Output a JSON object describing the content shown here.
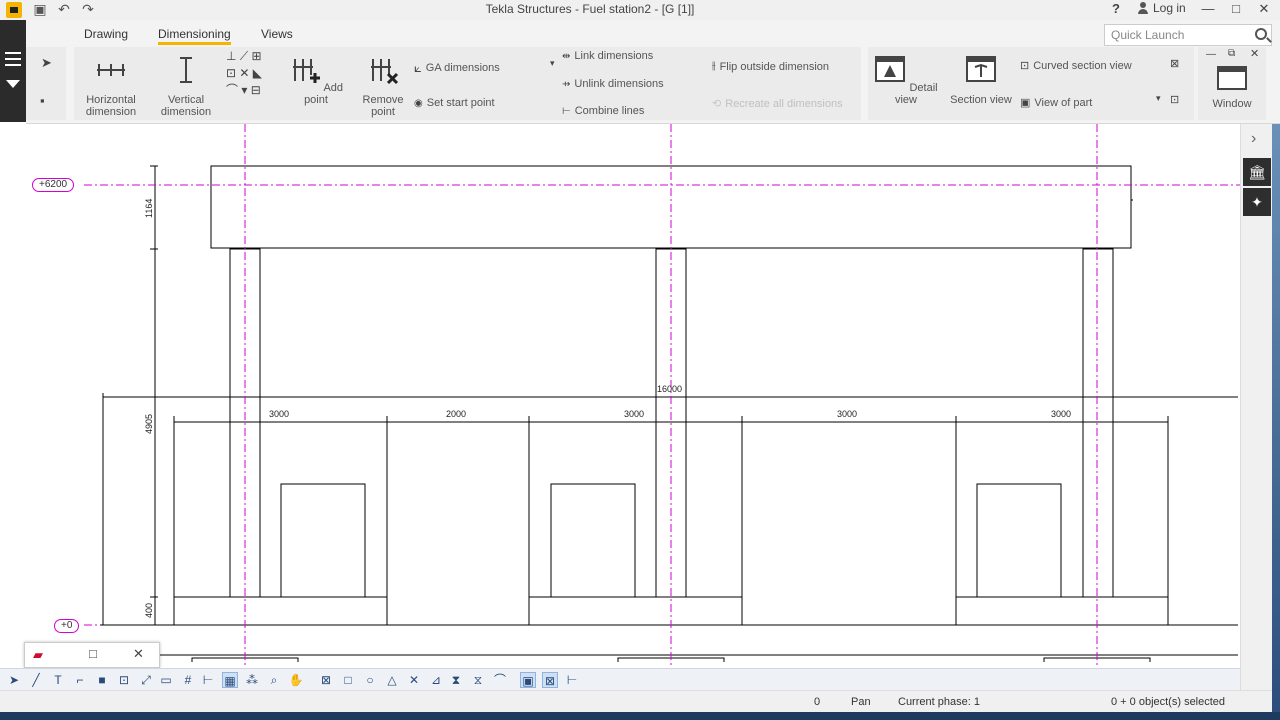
{
  "titlebar": {
    "title": "Tekla Structures - Fuel station2 - [G  [1]]",
    "help": "?",
    "login": "Log in",
    "minimize": "—",
    "restore": "□",
    "close": "✕"
  },
  "tabs": [
    {
      "label": "Drawing"
    },
    {
      "label": "Dimensioning"
    },
    {
      "label": "Views"
    }
  ],
  "quick_launch": {
    "placeholder": "Quick Launch"
  },
  "ribbon": {
    "horizontal_dimension": "Horizontal dimension",
    "vertical_dimension": "Vertical dimension",
    "add_point": "Add point",
    "remove_point": "Remove point",
    "ga_dimensions": "GA dimensions",
    "set_start_point": "Set start point",
    "link_dimensions": "Link dimensions",
    "unlink_dimensions": "Unlink dimensions",
    "combine_lines": "Combine lines",
    "flip_outside_dimension": "Flip outside dimension",
    "recreate_all_dimensions": "Recreate all dimensions",
    "detail_view": "Detail view",
    "section_view": "Section view",
    "curved_section_view": "Curved section view",
    "view_of_part": "View of part",
    "window": "Window"
  },
  "drawing": {
    "level_top": "+6200",
    "level_bottom": "+0",
    "dim_overall": "16000",
    "dims_horizontal": [
      "3000",
      "2000",
      "3000",
      "3000",
      "3000"
    ],
    "dim_beam_height": "1164",
    "dim_mid_height": "4905",
    "dim_base_height": "400"
  },
  "statusbar": {
    "coord": "0",
    "mode": "Pan",
    "phase": "Current phase: 1",
    "selected": "0 + 0 object(s) selected"
  },
  "colors": {
    "accent": "#f5b400",
    "gridline": "#d400d4",
    "ribbon_bg": "#f3f3f3",
    "left_strip": "#2b2b2b"
  }
}
